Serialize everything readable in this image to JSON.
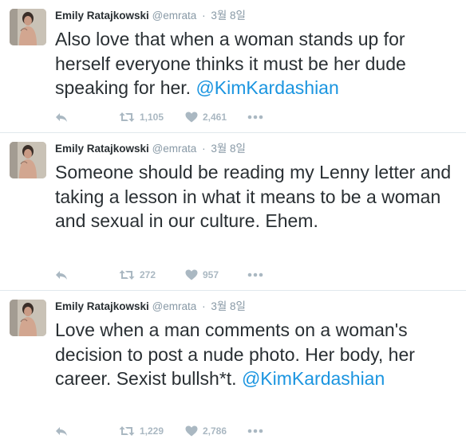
{
  "colors": {
    "link": "#1b95e0",
    "meta": "#8899a6",
    "action": "#aab8c2",
    "text": "#292f33"
  },
  "tweets": [
    {
      "name": "Emily Ratajkowski",
      "handle": "@emrata",
      "sep": "·",
      "time": "3월 8일",
      "text": "Also love that when a woman stands up for herself everyone thinks it must be her dude speaking for her. ",
      "mention": "@KimKardashian",
      "retweets": "1,105",
      "likes": "2,461"
    },
    {
      "name": "Emily Ratajkowski",
      "handle": "@emrata",
      "sep": "·",
      "time": "3월 8일",
      "text": "Someone should be reading my Lenny letter and taking a lesson in what it means to be a woman and sexual in our culture. Ehem.",
      "retweets": "272",
      "likes": "957"
    },
    {
      "name": "Emily Ratajkowski",
      "handle": "@emrata",
      "sep": "·",
      "time": "3월 8일",
      "text": "Love when a man comments on a woman's decision to post a nude photo. Her body, her career. Sexist bullsh*t. ",
      "mention": "@KimKardashian",
      "retweets": "1,229",
      "likes": "2,786"
    }
  ],
  "icons": {
    "reply": "reply-icon",
    "retweet": "retweet-icon",
    "like": "heart-icon",
    "more": "more-icon"
  }
}
